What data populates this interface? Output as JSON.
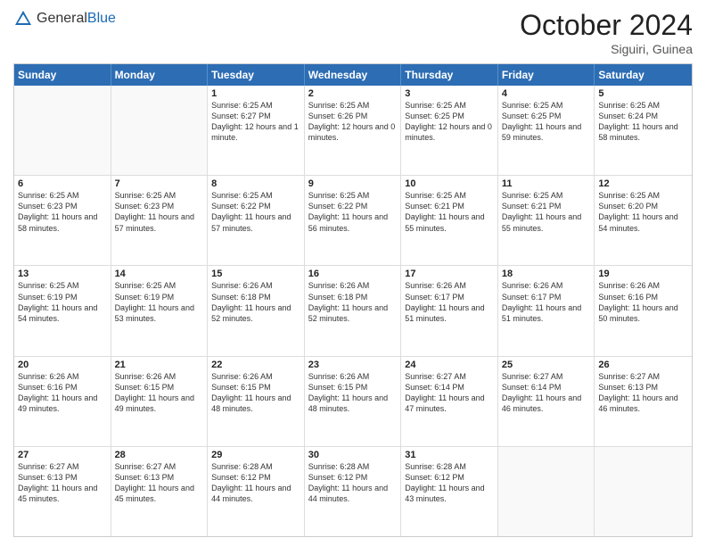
{
  "header": {
    "logo_general": "General",
    "logo_blue": "Blue",
    "title": "October 2024",
    "location": "Siguiri, Guinea"
  },
  "days": [
    "Sunday",
    "Monday",
    "Tuesday",
    "Wednesday",
    "Thursday",
    "Friday",
    "Saturday"
  ],
  "weeks": [
    [
      {
        "day": "",
        "empty": true
      },
      {
        "day": "",
        "empty": true
      },
      {
        "day": "1",
        "sunrise": "Sunrise: 6:25 AM",
        "sunset": "Sunset: 6:27 PM",
        "daylight": "Daylight: 12 hours and 1 minute."
      },
      {
        "day": "2",
        "sunrise": "Sunrise: 6:25 AM",
        "sunset": "Sunset: 6:26 PM",
        "daylight": "Daylight: 12 hours and 0 minutes."
      },
      {
        "day": "3",
        "sunrise": "Sunrise: 6:25 AM",
        "sunset": "Sunset: 6:25 PM",
        "daylight": "Daylight: 12 hours and 0 minutes."
      },
      {
        "day": "4",
        "sunrise": "Sunrise: 6:25 AM",
        "sunset": "Sunset: 6:25 PM",
        "daylight": "Daylight: 11 hours and 59 minutes."
      },
      {
        "day": "5",
        "sunrise": "Sunrise: 6:25 AM",
        "sunset": "Sunset: 6:24 PM",
        "daylight": "Daylight: 11 hours and 58 minutes."
      }
    ],
    [
      {
        "day": "6",
        "sunrise": "Sunrise: 6:25 AM",
        "sunset": "Sunset: 6:23 PM",
        "daylight": "Daylight: 11 hours and 58 minutes."
      },
      {
        "day": "7",
        "sunrise": "Sunrise: 6:25 AM",
        "sunset": "Sunset: 6:23 PM",
        "daylight": "Daylight: 11 hours and 57 minutes."
      },
      {
        "day": "8",
        "sunrise": "Sunrise: 6:25 AM",
        "sunset": "Sunset: 6:22 PM",
        "daylight": "Daylight: 11 hours and 57 minutes."
      },
      {
        "day": "9",
        "sunrise": "Sunrise: 6:25 AM",
        "sunset": "Sunset: 6:22 PM",
        "daylight": "Daylight: 11 hours and 56 minutes."
      },
      {
        "day": "10",
        "sunrise": "Sunrise: 6:25 AM",
        "sunset": "Sunset: 6:21 PM",
        "daylight": "Daylight: 11 hours and 55 minutes."
      },
      {
        "day": "11",
        "sunrise": "Sunrise: 6:25 AM",
        "sunset": "Sunset: 6:21 PM",
        "daylight": "Daylight: 11 hours and 55 minutes."
      },
      {
        "day": "12",
        "sunrise": "Sunrise: 6:25 AM",
        "sunset": "Sunset: 6:20 PM",
        "daylight": "Daylight: 11 hours and 54 minutes."
      }
    ],
    [
      {
        "day": "13",
        "sunrise": "Sunrise: 6:25 AM",
        "sunset": "Sunset: 6:19 PM",
        "daylight": "Daylight: 11 hours and 54 minutes."
      },
      {
        "day": "14",
        "sunrise": "Sunrise: 6:25 AM",
        "sunset": "Sunset: 6:19 PM",
        "daylight": "Daylight: 11 hours and 53 minutes."
      },
      {
        "day": "15",
        "sunrise": "Sunrise: 6:26 AM",
        "sunset": "Sunset: 6:18 PM",
        "daylight": "Daylight: 11 hours and 52 minutes."
      },
      {
        "day": "16",
        "sunrise": "Sunrise: 6:26 AM",
        "sunset": "Sunset: 6:18 PM",
        "daylight": "Daylight: 11 hours and 52 minutes."
      },
      {
        "day": "17",
        "sunrise": "Sunrise: 6:26 AM",
        "sunset": "Sunset: 6:17 PM",
        "daylight": "Daylight: 11 hours and 51 minutes."
      },
      {
        "day": "18",
        "sunrise": "Sunrise: 6:26 AM",
        "sunset": "Sunset: 6:17 PM",
        "daylight": "Daylight: 11 hours and 51 minutes."
      },
      {
        "day": "19",
        "sunrise": "Sunrise: 6:26 AM",
        "sunset": "Sunset: 6:16 PM",
        "daylight": "Daylight: 11 hours and 50 minutes."
      }
    ],
    [
      {
        "day": "20",
        "sunrise": "Sunrise: 6:26 AM",
        "sunset": "Sunset: 6:16 PM",
        "daylight": "Daylight: 11 hours and 49 minutes."
      },
      {
        "day": "21",
        "sunrise": "Sunrise: 6:26 AM",
        "sunset": "Sunset: 6:15 PM",
        "daylight": "Daylight: 11 hours and 49 minutes."
      },
      {
        "day": "22",
        "sunrise": "Sunrise: 6:26 AM",
        "sunset": "Sunset: 6:15 PM",
        "daylight": "Daylight: 11 hours and 48 minutes."
      },
      {
        "day": "23",
        "sunrise": "Sunrise: 6:26 AM",
        "sunset": "Sunset: 6:15 PM",
        "daylight": "Daylight: 11 hours and 48 minutes."
      },
      {
        "day": "24",
        "sunrise": "Sunrise: 6:27 AM",
        "sunset": "Sunset: 6:14 PM",
        "daylight": "Daylight: 11 hours and 47 minutes."
      },
      {
        "day": "25",
        "sunrise": "Sunrise: 6:27 AM",
        "sunset": "Sunset: 6:14 PM",
        "daylight": "Daylight: 11 hours and 46 minutes."
      },
      {
        "day": "26",
        "sunrise": "Sunrise: 6:27 AM",
        "sunset": "Sunset: 6:13 PM",
        "daylight": "Daylight: 11 hours and 46 minutes."
      }
    ],
    [
      {
        "day": "27",
        "sunrise": "Sunrise: 6:27 AM",
        "sunset": "Sunset: 6:13 PM",
        "daylight": "Daylight: 11 hours and 45 minutes."
      },
      {
        "day": "28",
        "sunrise": "Sunrise: 6:27 AM",
        "sunset": "Sunset: 6:13 PM",
        "daylight": "Daylight: 11 hours and 45 minutes."
      },
      {
        "day": "29",
        "sunrise": "Sunrise: 6:28 AM",
        "sunset": "Sunset: 6:12 PM",
        "daylight": "Daylight: 11 hours and 44 minutes."
      },
      {
        "day": "30",
        "sunrise": "Sunrise: 6:28 AM",
        "sunset": "Sunset: 6:12 PM",
        "daylight": "Daylight: 11 hours and 44 minutes."
      },
      {
        "day": "31",
        "sunrise": "Sunrise: 6:28 AM",
        "sunset": "Sunset: 6:12 PM",
        "daylight": "Daylight: 11 hours and 43 minutes."
      },
      {
        "day": "",
        "empty": true
      },
      {
        "day": "",
        "empty": true
      }
    ]
  ]
}
